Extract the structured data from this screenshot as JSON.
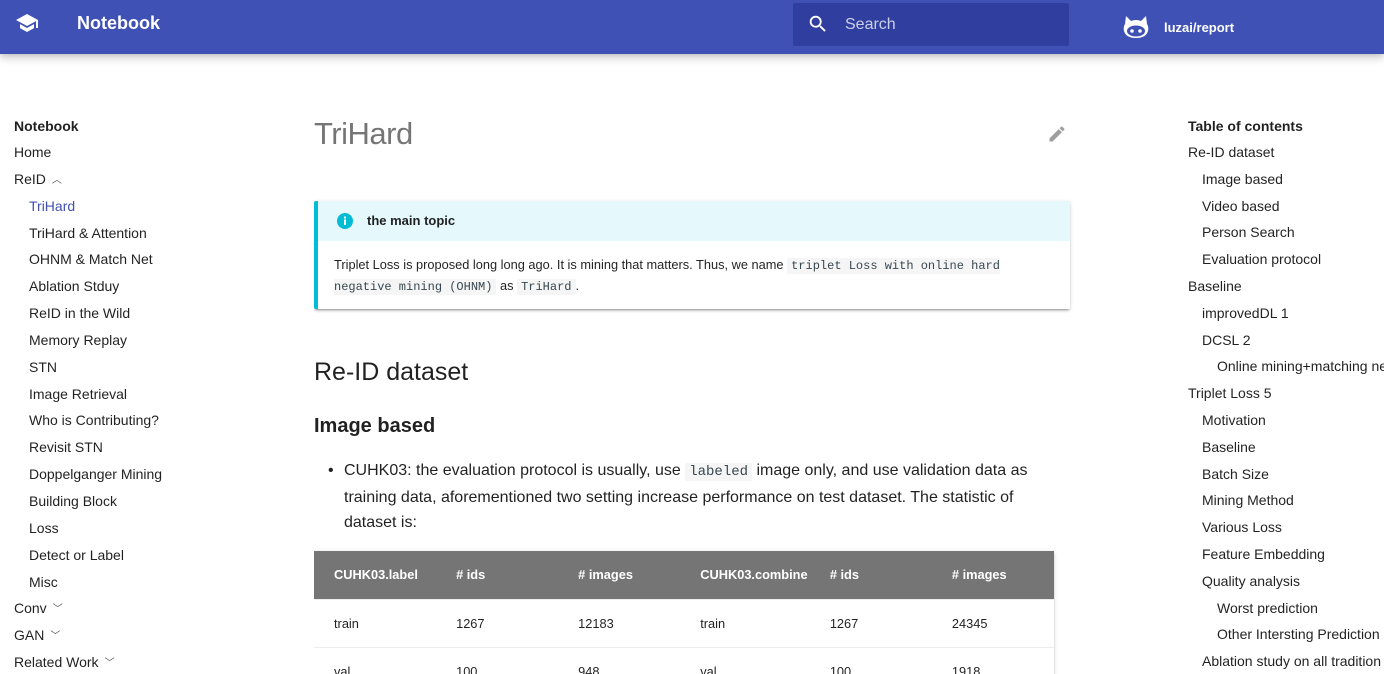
{
  "header": {
    "site_title": "Notebook",
    "search_placeholder": "Search",
    "repo_label": "luzai/report",
    "logo_icon": "graduation-cap-icon",
    "repo_icon": "github-icon",
    "color": "#3f51b5",
    "search_bg": "#303f9f"
  },
  "nav": {
    "title": "Notebook",
    "items": [
      {
        "label": "Home"
      },
      {
        "label": "ReID",
        "expanded": true
      },
      {
        "label": "TriHard",
        "sub": true,
        "active": true
      },
      {
        "label": "TriHard & Attention",
        "sub": true
      },
      {
        "label": "OHNM & Match Net",
        "sub": true
      },
      {
        "label": "Ablation Stduy",
        "sub": true
      },
      {
        "label": "ReID in the Wild",
        "sub": true
      },
      {
        "label": "Memory Replay",
        "sub": true
      },
      {
        "label": "STN",
        "sub": true
      },
      {
        "label": "Image Retrieval",
        "sub": true
      },
      {
        "label": "Who is Contributing?",
        "sub": true
      },
      {
        "label": "Revisit STN",
        "sub": true
      },
      {
        "label": "Doppelganger Mining",
        "sub": true
      },
      {
        "label": "Building Block",
        "sub": true
      },
      {
        "label": "Loss",
        "sub": true
      },
      {
        "label": "Detect or Label",
        "sub": true
      },
      {
        "label": "Misc",
        "sub": true
      },
      {
        "label": "Conv",
        "expanded": false
      },
      {
        "label": "GAN",
        "expanded": false
      },
      {
        "label": "Related Work",
        "expanded": false
      }
    ]
  },
  "toc": {
    "title": "Table of contents",
    "items": [
      {
        "label": "Re-ID dataset",
        "level": 1
      },
      {
        "label": "Image based",
        "level": 2
      },
      {
        "label": "Video based",
        "level": 2
      },
      {
        "label": "Person Search",
        "level": 2
      },
      {
        "label": "Evaluation protocol",
        "level": 2
      },
      {
        "label": "Baseline",
        "level": 1
      },
      {
        "label": "improvedDL 1",
        "level": 2
      },
      {
        "label": "DCSL 2",
        "level": 2
      },
      {
        "label": "Online mining+matching ne",
        "level": 3
      },
      {
        "label": "Triplet Loss 5",
        "level": 1
      },
      {
        "label": "Motivation",
        "level": 2
      },
      {
        "label": "Baseline",
        "level": 2
      },
      {
        "label": "Batch Size",
        "level": 2
      },
      {
        "label": "Mining Method",
        "level": 2
      },
      {
        "label": "Various Loss",
        "level": 2
      },
      {
        "label": "Feature Embedding",
        "level": 2
      },
      {
        "label": "Quality analysis",
        "level": 2
      },
      {
        "label": "Worst prediction",
        "level": 3
      },
      {
        "label": "Other Intersting Prediction",
        "level": 3
      },
      {
        "label": "Ablation study on all tradition",
        "level": 2
      }
    ]
  },
  "main": {
    "page_title": "TriHard",
    "edit_icon": "pencil-icon",
    "admonition": {
      "icon": "info-icon",
      "color": "#00bcd4",
      "title": "the main topic",
      "text_1": "Triplet Loss is proposed long long ago. It is mining that matters. Thus, we name ",
      "code_1": "triplet Loss with online hard negative mining (OHNM)",
      "text_2": " as ",
      "code_2": "TriHard",
      "text_3": "."
    },
    "h2": "Re-ID dataset",
    "h3": "Image based",
    "bullet": {
      "text_1": "CUHK03: the evaluation protocol is usually, use ",
      "code": "labeled",
      "text_2": " image only, and use validation data as training data, aforementioned two setting increase performance on test dataset. The statistic of dataset is:"
    },
    "table": {
      "headers": [
        "CUHK03.label",
        "# ids",
        "# images",
        "CUHK03.combine",
        "# ids",
        "# images"
      ],
      "rows": [
        [
          "train",
          "1267",
          "12183",
          "train",
          "1267",
          "24345"
        ],
        [
          "val",
          "100",
          "948",
          "val",
          "100",
          "1918"
        ]
      ]
    }
  }
}
